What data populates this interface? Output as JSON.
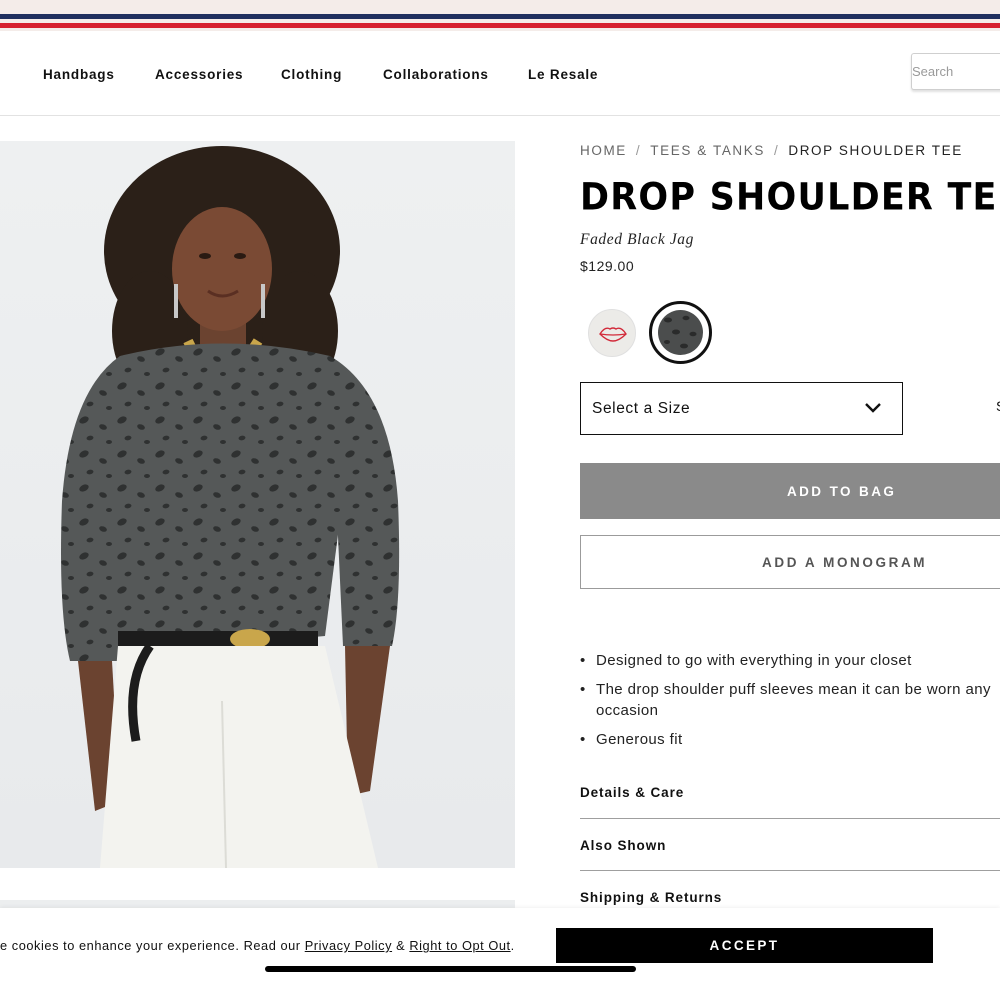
{
  "nav": {
    "items": [
      "Handbags",
      "Accessories",
      "Clothing",
      "Collaborations",
      "Le Resale"
    ],
    "search_placeholder": "Search"
  },
  "breadcrumb": {
    "items": [
      "HOME",
      "TEES & TANKS"
    ],
    "current": "DROP SHOULDER TEE",
    "separator": "/"
  },
  "product": {
    "title": "DROP SHOULDER TEE",
    "color_name": "Faded Black Jag",
    "price": "$129.00",
    "swatches": [
      {
        "name": "lips",
        "selected": false
      },
      {
        "name": "faded-black-jag",
        "selected": true
      }
    ],
    "size_select": {
      "label": "Select a Size",
      "edge_text": "S"
    },
    "add_to_bag_label": "ADD TO BAG",
    "monogram_label": "ADD A MONOGRAM",
    "bullets": [
      "Designed to go with everything in your closet",
      "The drop shoulder puff sleeves mean it can be worn any occasion",
      "Generous fit"
    ],
    "accordions": [
      "Details & Care",
      "Also Shown",
      "Shipping & Returns"
    ]
  },
  "cookie": {
    "text_before": "e cookies to enhance your experience. Read our ",
    "privacy_link": "Privacy Policy",
    "amp": " & ",
    "opt_out_link": "Right to Opt Out",
    "period": ".",
    "accept_label": "ACCEPT"
  },
  "colors": {
    "stripe_navy": "#1f2f5e",
    "stripe_red": "#d6202f",
    "add_to_bag_bg": "#8a8a8a",
    "accept_bg": "#000000"
  }
}
